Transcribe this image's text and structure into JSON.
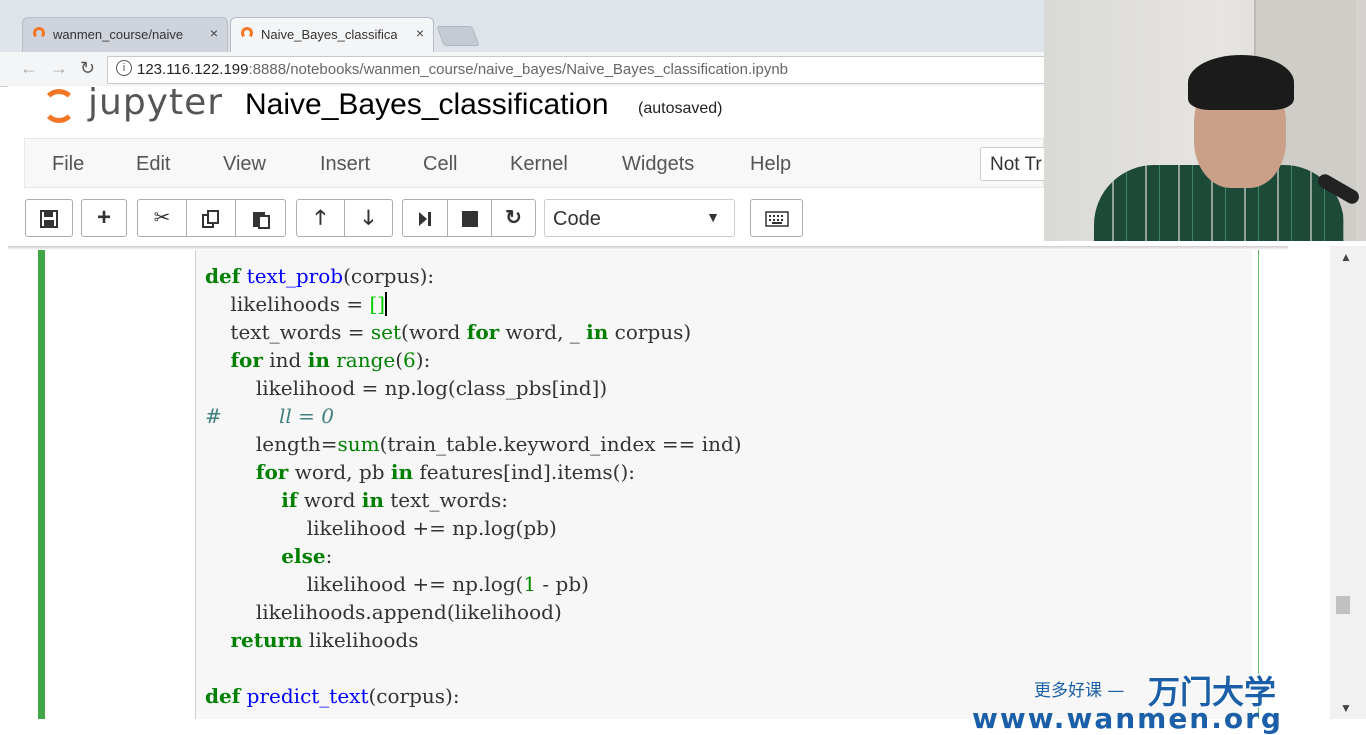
{
  "browser": {
    "tabs": [
      {
        "label": "wanmen_course/naive",
        "close": "×"
      },
      {
        "label": "Naive_Bayes_classificat",
        "close": "×"
      }
    ],
    "url_host": "123.116.122.199",
    "url_path": ":8888/notebooks/wanmen_course/naive_bayes/Naive_Bayes_classification.ipynb",
    "info_icon": "i"
  },
  "jupyter": {
    "logo_text": "jupyter",
    "notebook_title": "Naive_Bayes_classification",
    "save_status": "(autosaved)",
    "menu": [
      "File",
      "Edit",
      "View",
      "Insert",
      "Cell",
      "Kernel",
      "Widgets",
      "Help"
    ],
    "trust_label": "Not Tr",
    "cell_type": "Code",
    "toolbar_icons": [
      "save-icon",
      "add-icon",
      "cut-icon",
      "copy-icon",
      "paste-icon",
      "move-up-icon",
      "move-down-icon",
      "run-icon",
      "stop-icon",
      "restart-icon",
      "keyboard-icon"
    ]
  },
  "watermark": {
    "slogan": "更多好课 —",
    "brand": "万门大学",
    "url": "www.wanmen.org"
  },
  "colors": {
    "accent_orange": "#f37626",
    "cell_edit_green": "#42a649",
    "watermark_blue": "#1b5fa8"
  }
}
